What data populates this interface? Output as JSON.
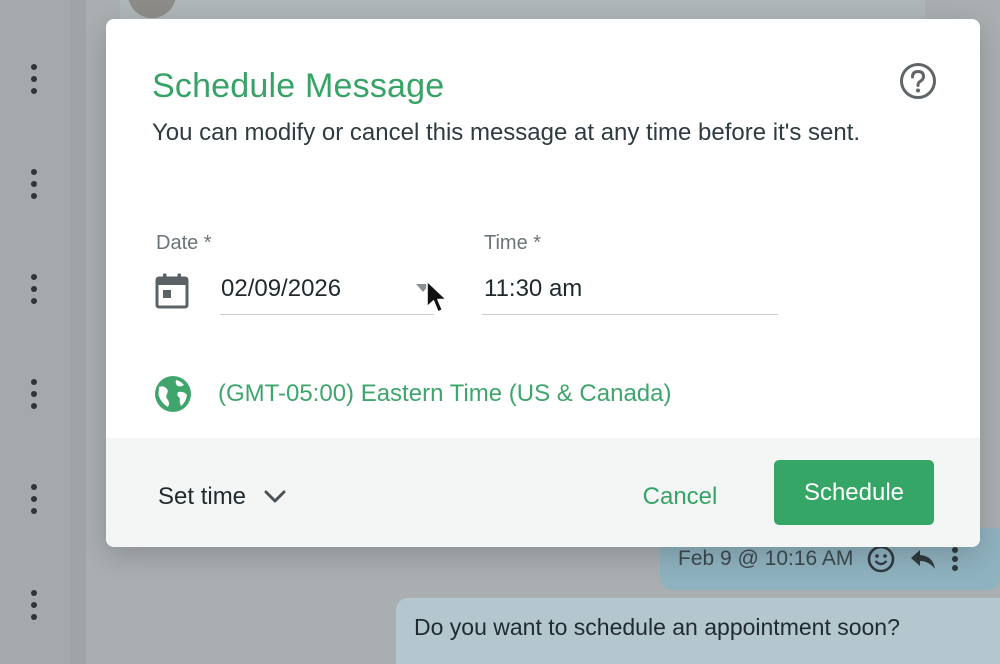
{
  "modal": {
    "title": "Schedule Message",
    "description": "You can modify or cancel this message at any time before it's sent.",
    "date_label": "Date *",
    "date_value": "02/09/2026",
    "time_label": "Time *",
    "time_value": "11:30 am",
    "timezone": "(GMT-05:00) Eastern Time (US & Canada)",
    "set_time_label": "Set time",
    "cancel_label": "Cancel",
    "schedule_label": "Schedule"
  },
  "icons": {
    "help": "help-circle-icon",
    "calendar": "calendar-icon",
    "globe": "globe-icon",
    "chevron": "chevron-down-icon",
    "cursor": "mouse-pointer-icon"
  },
  "background": {
    "sent_meta": "Feb 9 @ 10:16 AM",
    "received_text": "Do you want to schedule an appointment soon?"
  },
  "colors": {
    "accent": "#37a366",
    "button": "#36a667",
    "text": "#2e3b40"
  }
}
